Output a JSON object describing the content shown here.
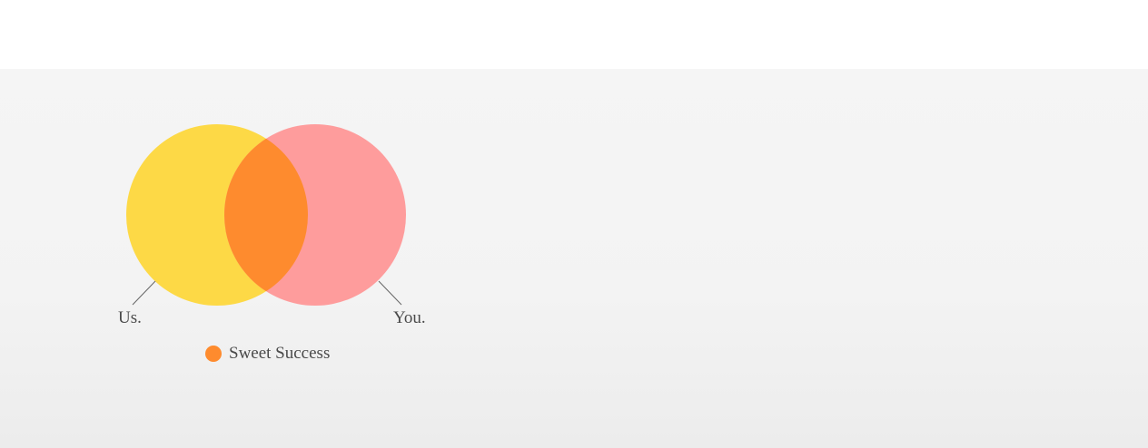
{
  "venn": {
    "sets": [
      {
        "label": "Us.",
        "color": "#fdd946"
      },
      {
        "label": "You.",
        "color": "#fe9c9c"
      }
    ],
    "intersection": {
      "label": "Sweet Success",
      "color": "#fe8b2e"
    }
  }
}
